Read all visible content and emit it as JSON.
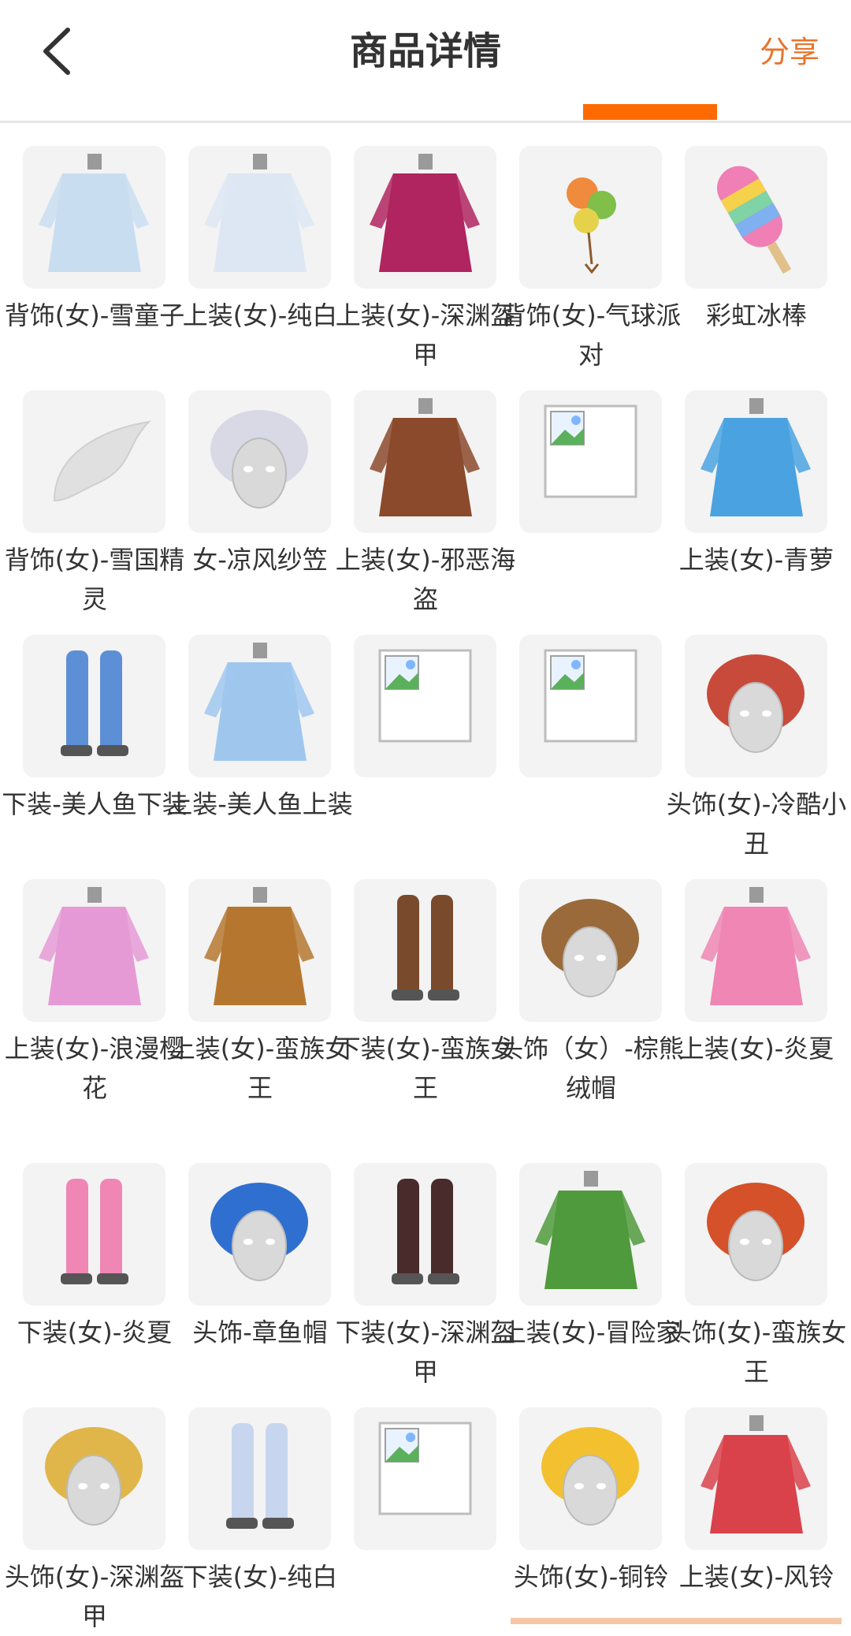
{
  "header": {
    "title": "商品详情",
    "share": "分享"
  },
  "items": [
    {
      "label": "背饰(女)-雪童子",
      "icon": "snow-spirit-icon",
      "color": "#c9ddf1"
    },
    {
      "label": "上装(女)-纯白",
      "icon": "white-dress-icon",
      "color": "#dde7f3"
    },
    {
      "label": "上装(女)-深渊盔甲",
      "icon": "abyss-armor-icon",
      "color": "#b0245f"
    },
    {
      "label": "背饰(女)-气球派对",
      "icon": "balloon-icon",
      "color": "#7fbf4a"
    },
    {
      "label": "彩虹冰棒",
      "icon": "popsicle-icon",
      "color": "#ef7fb5"
    },
    {
      "label": "背饰(女)-雪国精灵",
      "icon": "wing-icon",
      "color": "#e8e8e8"
    },
    {
      "label": "女-凉风纱笠",
      "icon": "veil-hat-icon",
      "color": "#d9d9e6"
    },
    {
      "label": "上装(女)-邪恶海盗",
      "icon": "pirate-coat-icon",
      "color": "#8b4a2b"
    },
    {
      "label": "",
      "icon": "broken-image-icon",
      "color": "#cccccc"
    },
    {
      "label": "上装(女)-青萝",
      "icon": "qingluo-dress-icon",
      "color": "#4aa3e0"
    },
    {
      "label": "下装-美人鱼下装",
      "icon": "mermaid-bottom-icon",
      "color": "#5d8fd6"
    },
    {
      "label": "上装-美人鱼上装",
      "icon": "mermaid-top-icon",
      "color": "#9fc7ee"
    },
    {
      "label": "",
      "icon": "broken-image-icon",
      "color": "#cccccc"
    },
    {
      "label": "",
      "icon": "broken-image-icon",
      "color": "#cccccc"
    },
    {
      "label": "头饰(女)-冷酷小丑",
      "icon": "clown-hair-icon",
      "color": "#c84a3b"
    },
    {
      "label": "上装(女)-浪漫樱花",
      "icon": "sakura-dress-icon",
      "color": "#e59ad6"
    },
    {
      "label": "上装(女)-蛮族女王",
      "icon": "barbarian-top-icon",
      "color": "#b5772f"
    },
    {
      "label": "下装(女)-蛮族女王",
      "icon": "barbarian-boots-icon",
      "color": "#7a4a2c"
    },
    {
      "label": "头饰（女）-棕熊绒帽",
      "icon": "bear-hat-icon",
      "color": "#9a6a3a"
    },
    {
      "label": "上装(女)-炎夏",
      "icon": "bikini-top-icon",
      "color": "#ef86b4"
    },
    {
      "label": "下装(女)-炎夏",
      "icon": "pink-skirt-icon",
      "color": "#ef86b4"
    },
    {
      "label": "头饰-章鱼帽",
      "icon": "octopus-hat-icon",
      "color": "#2f6fd0"
    },
    {
      "label": "下装(女)-深渊盔甲",
      "icon": "abyss-boots-icon",
      "color": "#4a2b2b"
    },
    {
      "label": "上装(女)-冒险家",
      "icon": "adventurer-jacket-icon",
      "color": "#4f9a3c"
    },
    {
      "label": "头饰(女)-蛮族女王",
      "icon": "red-dreadlocks-icon",
      "color": "#d4512a"
    },
    {
      "label": "头饰(女)-深渊盔甲",
      "icon": "abyss-headband-icon",
      "color": "#e0b64a"
    },
    {
      "label": "下装(女)-纯白",
      "icon": "white-heels-icon",
      "color": "#c7d6ee"
    },
    {
      "label": "",
      "icon": "broken-image-icon",
      "color": "#cccccc"
    },
    {
      "label": "头饰(女)-铜铃",
      "icon": "golden-hair-icon",
      "color": "#f3c12f"
    },
    {
      "label": "上装(女)-风铃",
      "icon": "red-kimono-icon",
      "color": "#d9424a"
    }
  ]
}
